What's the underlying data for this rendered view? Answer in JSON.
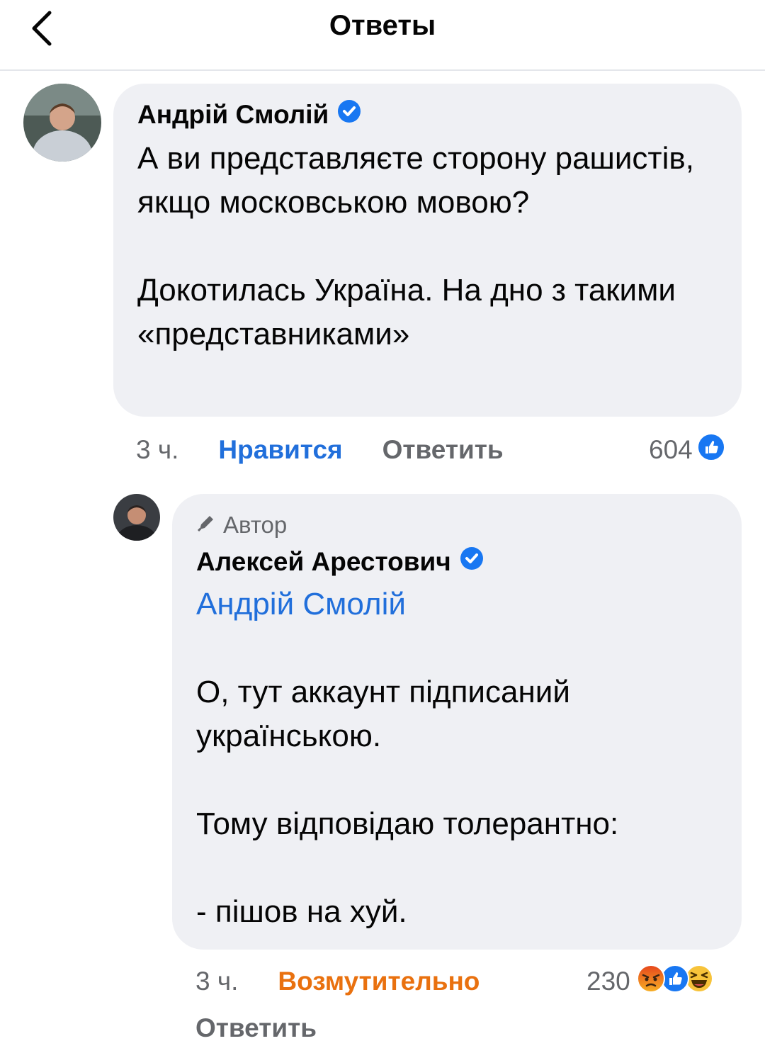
{
  "header": {
    "title": "Ответы",
    "back_icon": "chevron-left-icon"
  },
  "comment": {
    "author": "Андрій Смолій",
    "verified": true,
    "paragraphs": [
      "А ви представляєте сторону рашистів, якщо московською мовою?",
      "Докотилась Україна. На дно з такими «представниками»"
    ],
    "time": "3 ч.",
    "like_label": "Нравится",
    "reply_label": "Ответить",
    "reaction_count": "604",
    "reactions": [
      "like-icon"
    ]
  },
  "reply": {
    "badge": "Автор",
    "author": "Алексей Арестович",
    "verified": true,
    "mention": "Андрій Смолій",
    "paragraphs": [
      "О, тут аккаунт підписаний українською.",
      "Тому відповідаю толерантно:",
      "- пішов на хуй."
    ],
    "time": "3 ч.",
    "reaction_label": "Возмутительно",
    "reply_label": "Ответить",
    "reaction_count": "230",
    "reactions": [
      "angry-icon",
      "like-icon",
      "haha-icon"
    ]
  },
  "colors": {
    "link_blue": "#216fdb",
    "angry_orange": "#e9710f",
    "bubble": "#eff0f4",
    "meta_gray": "#65676b"
  }
}
